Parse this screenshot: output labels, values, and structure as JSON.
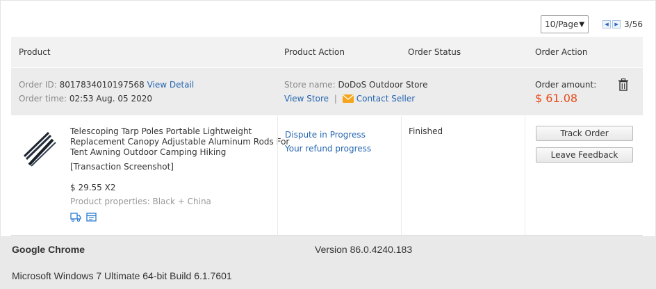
{
  "pager": {
    "page_size": "10/Page",
    "page_count": "3/56"
  },
  "table_headers": {
    "product": "Product",
    "product_action": "Product Action",
    "order_status": "Order Status",
    "order_action": "Order Action"
  },
  "order": {
    "id_label": "Order ID:",
    "id_value": "8017834010197568",
    "view_detail": "View Detail",
    "time_label": "Order time:",
    "time_value": "02:53 Aug. 05 2020",
    "store_label": "Store name:",
    "store_value": "DoDoS Outdoor Store",
    "view_store": "View Store",
    "separator": "|",
    "contact_seller": "Contact Seller",
    "amount_label": "Order amount:",
    "amount_value": "$ 61.08"
  },
  "item": {
    "title_line1": "Telescoping Tarp Poles Portable Lightweight",
    "title_line2": "Replacement Canopy Adjustable Aluminum Rods For",
    "title_line3": "Tent Awning Outdoor Camping Hiking",
    "snapshot": "[Transaction Screenshot]",
    "price": "$ 29.55 X2",
    "properties_label": "Product properties:",
    "properties_value": "Black + China",
    "action_dispute": "Dispute in Progress",
    "action_refund": "Your refund progress",
    "status": "Finished",
    "track_order": "Track Order",
    "leave_feedback": "Leave Feedback"
  },
  "chrome": {
    "browser": "Google Chrome",
    "version": "Version 86.0.4240.183",
    "os": "Microsoft Windows 7 Ultimate  64-bit Build 6.1.7601"
  },
  "colors": {
    "link": "#2566b0",
    "amount": "#e64a19",
    "mail_icon": "#f4a51c"
  },
  "icons": [
    "chevron-down-icon",
    "prev-page-icon",
    "next-page-icon",
    "trash-icon",
    "mail-icon",
    "shipping-icon",
    "list-icon"
  ]
}
